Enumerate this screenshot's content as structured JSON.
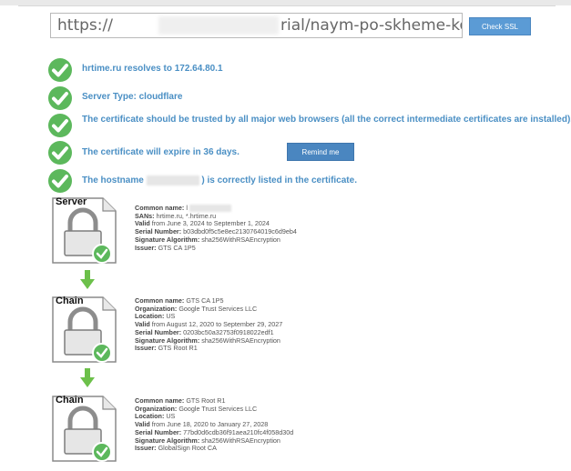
{
  "url_bar": {
    "url_start": "https://",
    "url_end": "rial/naym-po-skheme-kompan",
    "check_button": "Check SSL"
  },
  "results": [
    {
      "text": "hrtime.ru resolves to 172.64.80.1"
    },
    {
      "text": "Server Type: cloudflare"
    },
    {
      "text": "The certificate should be trusted by all major web browsers (all the correct intermediate certificates are installed)."
    },
    {
      "text": "The certificate will expire in 36 days.",
      "button": "Remind me"
    },
    {
      "text_before": "The hostname",
      "text_after": ") is correctly listed in the certificate."
    }
  ],
  "chain": [
    {
      "label": "Server",
      "lines": [
        {
          "label": "Common name:",
          "value": "l"
        },
        {
          "label": "SANs:",
          "value": "hrtime.ru, *.hrtime.ru"
        },
        {
          "label": "Valid",
          "value": "from June 3, 2024 to September 1, 2024"
        },
        {
          "label": "Serial Number:",
          "value": "b03dbd0f5c5e8ec2130764019c6d9eb4"
        },
        {
          "label": "Signature Algorithm:",
          "value": "sha256WithRSAEncryption"
        },
        {
          "label": "Issuer:",
          "value": "GTS CA 1P5"
        }
      ]
    },
    {
      "label": "Chain",
      "lines": [
        {
          "label": "Common name:",
          "value": "GTS CA 1P5"
        },
        {
          "label": "Organization:",
          "value": "Google Trust Services LLC"
        },
        {
          "label": "Location:",
          "value": "US"
        },
        {
          "label": "Valid",
          "value": "from August 12, 2020 to September 29, 2027"
        },
        {
          "label": "Serial Number:",
          "value": "0203bc50a32753f0918022edf1"
        },
        {
          "label": "Signature Algorithm:",
          "value": "sha256WithRSAEncryption"
        },
        {
          "label": "Issuer:",
          "value": "GTS Root R1"
        }
      ]
    },
    {
      "label": "Chain",
      "lines": [
        {
          "label": "Common name:",
          "value": "GTS Root R1"
        },
        {
          "label": "Organization:",
          "value": "Google Trust Services LLC"
        },
        {
          "label": "Location:",
          "value": "US"
        },
        {
          "label": "Valid",
          "value": "from June 18, 2020 to January 27, 2028"
        },
        {
          "label": "Serial Number:",
          "value": "77bd0d6cdb36f91aea210fc4f058d30d"
        },
        {
          "label": "Signature Algorithm:",
          "value": "sha256WithRSAEncryption"
        },
        {
          "label": "Issuer:",
          "value": "GlobalSign Root CA"
        }
      ]
    }
  ],
  "colors": {
    "check_green": "#5cb85c",
    "result_text": "#4a8fc4",
    "button_blue": "#4a86c0",
    "arrow_green": "#6cc04a"
  }
}
